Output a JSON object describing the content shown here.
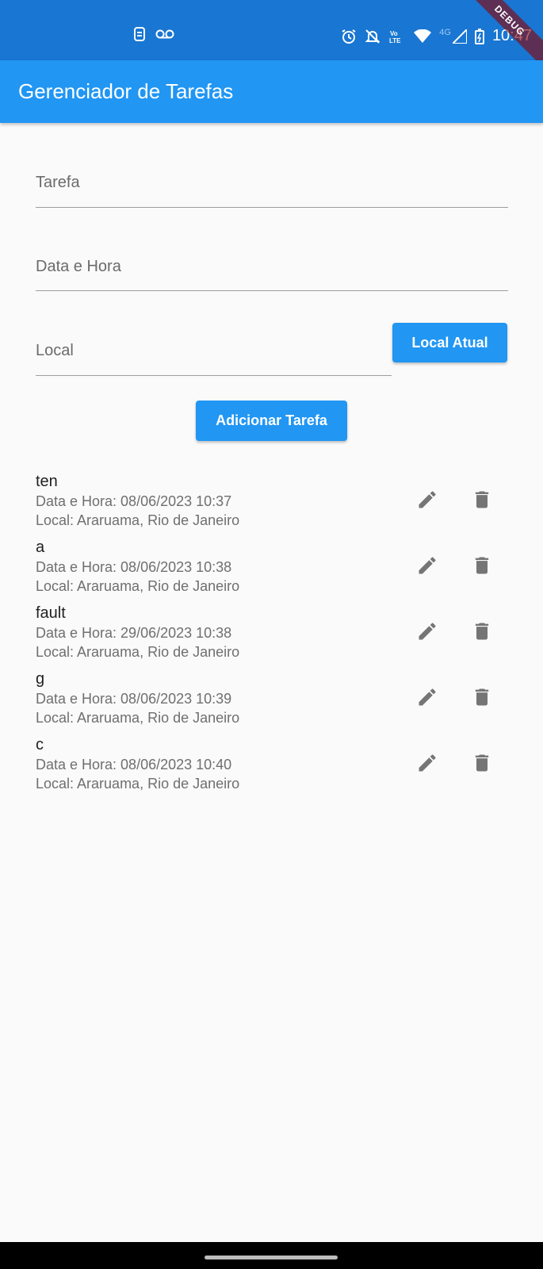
{
  "status_bar": {
    "time": "10:47",
    "network_label": "4G",
    "debug_label": "DEBUG",
    "icons": [
      "sim-icon",
      "voicemail-icon",
      "alarm-icon",
      "notifications-off-icon",
      "volte-icon",
      "wifi-icon",
      "signal-icon",
      "battery-icon"
    ]
  },
  "app_bar": {
    "title": "Gerenciador de Tarefas",
    "color": "#2196f3"
  },
  "form": {
    "task_placeholder": "Tarefa",
    "datetime_placeholder": "Data e Hora",
    "location_placeholder": "Local",
    "current_location_button": "Local Atual",
    "add_task_button": "Adicionar Tarefa"
  },
  "tasks": [
    {
      "title": "ten",
      "datetime": "Data e Hora: 08/06/2023 10:37",
      "location": "Local: Araruama, Rio de Janeiro"
    },
    {
      "title": "a",
      "datetime": "Data e Hora: 08/06/2023 10:38",
      "location": "Local: Araruama, Rio de Janeiro"
    },
    {
      "title": "fault",
      "datetime": "Data e Hora: 29/06/2023 10:38",
      "location": "Local: Araruama, Rio de Janeiro"
    },
    {
      "title": "g",
      "datetime": "Data e Hora: 08/06/2023 10:39",
      "location": "Local: Araruama, Rio de Janeiro"
    },
    {
      "title": "c",
      "datetime": "Data e Hora: 08/06/2023 10:40",
      "location": "Local: Araruama, Rio de Janeiro"
    }
  ],
  "task_actions": {
    "edit_icon": "pencil-icon",
    "delete_icon": "trash-icon"
  }
}
